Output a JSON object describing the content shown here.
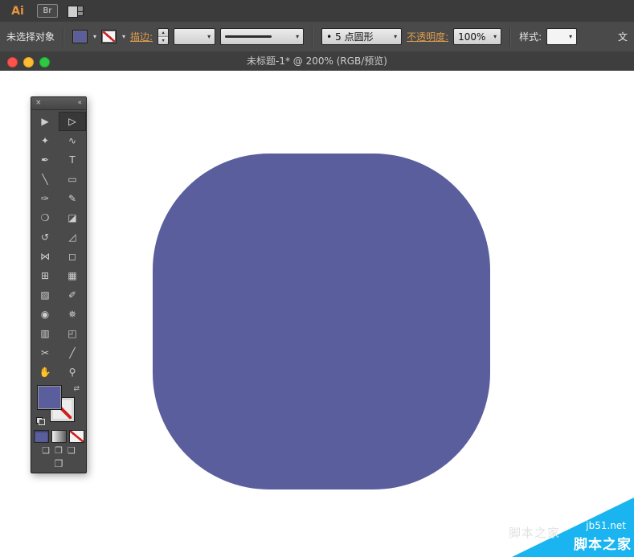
{
  "app_bar": {
    "logo": "Ai",
    "bridge_label": "Br"
  },
  "control_bar": {
    "no_selection": "未选择对象",
    "stroke_label": "描边:",
    "brush_bullet": "•",
    "brush_name": "5 点圆形",
    "opacity_label": "不透明度:",
    "opacity_value": "100%",
    "style_label": "样式:",
    "doc_setup_partial": "文"
  },
  "titlebar": {
    "title": "未标题-1* @ 200% (RGB/预览)"
  },
  "icons": {
    "dropdown": "▾",
    "step_up": "▴",
    "step_down": "▾",
    "swap": "⇄",
    "close": "×",
    "collapse": "«",
    "mode_normal": "❏",
    "mode_behind": "❐",
    "mode_inside": "❑",
    "screen_mode": "❐"
  },
  "tools": {
    "items": [
      {
        "name": "selection",
        "glyph": "▶"
      },
      {
        "name": "direct-selection",
        "glyph": "▷"
      },
      {
        "name": "magic-wand",
        "glyph": "✦"
      },
      {
        "name": "lasso",
        "glyph": "∿"
      },
      {
        "name": "pen",
        "glyph": "✒"
      },
      {
        "name": "type",
        "glyph": "T"
      },
      {
        "name": "line-segment",
        "glyph": "╲"
      },
      {
        "name": "rectangle",
        "glyph": "▭"
      },
      {
        "name": "paintbrush",
        "glyph": "✑"
      },
      {
        "name": "pencil",
        "glyph": "✎"
      },
      {
        "name": "blob-brush",
        "glyph": "❍"
      },
      {
        "name": "eraser",
        "glyph": "◪"
      },
      {
        "name": "rotate",
        "glyph": "↺"
      },
      {
        "name": "scale",
        "glyph": "◿"
      },
      {
        "name": "width",
        "glyph": "⋈"
      },
      {
        "name": "free-transform",
        "glyph": "◻"
      },
      {
        "name": "perspective-grid",
        "glyph": "⊞"
      },
      {
        "name": "mesh",
        "glyph": "▦"
      },
      {
        "name": "gradient",
        "glyph": "▨"
      },
      {
        "name": "eyedropper",
        "glyph": "✐"
      },
      {
        "name": "blend",
        "glyph": "◉"
      },
      {
        "name": "symbol-sprayer",
        "glyph": "✵"
      },
      {
        "name": "column-graph",
        "glyph": "▥"
      },
      {
        "name": "artboard",
        "glyph": "◰"
      },
      {
        "name": "slice",
        "glyph": "✂"
      },
      {
        "name": "knife",
        "glyph": "╱"
      },
      {
        "name": "hand",
        "glyph": "✋"
      },
      {
        "name": "zoom",
        "glyph": "⚲"
      }
    ]
  },
  "canvas": {
    "shape_color": "#5a5e9c"
  },
  "watermark": {
    "ghost": "脚本之家",
    "site": "jb51.net",
    "name": "脚本之家",
    "color": "#1ab5f1"
  }
}
